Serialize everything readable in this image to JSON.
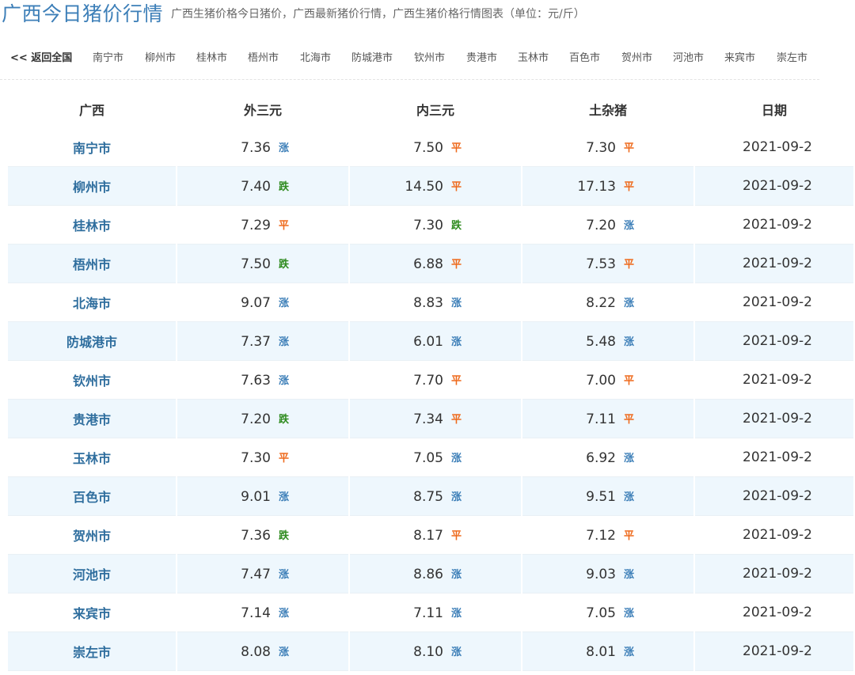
{
  "header": {
    "title": "广西今日猪价行情",
    "subtitle": "广西生猪价格今日猪价，广西最新猪价行情，广西生猪价格行情图表（单位：元/斤）"
  },
  "nav": {
    "back_label": "<< 返回全国",
    "cities": [
      "南宁市",
      "柳州市",
      "桂林市",
      "梧州市",
      "北海市",
      "防城港市",
      "钦州市",
      "贵港市",
      "玉林市",
      "百色市",
      "贺州市",
      "河池市",
      "来宾市",
      "崇左市"
    ]
  },
  "table": {
    "headers": [
      "广西",
      "外三元",
      "内三元",
      "土杂猪",
      "日期"
    ],
    "rows": [
      {
        "city": "南宁市",
        "wai": "7.36",
        "wai_trend": "涨",
        "nei": "7.50",
        "nei_trend": "平",
        "tu": "7.30",
        "tu_trend": "平",
        "date": "2021-09-2"
      },
      {
        "city": "柳州市",
        "wai": "7.40",
        "wai_trend": "跌",
        "nei": "14.50",
        "nei_trend": "平",
        "tu": "17.13",
        "tu_trend": "平",
        "date": "2021-09-2"
      },
      {
        "city": "桂林市",
        "wai": "7.29",
        "wai_trend": "平",
        "nei": "7.30",
        "nei_trend": "跌",
        "tu": "7.20",
        "tu_trend": "涨",
        "date": "2021-09-2"
      },
      {
        "city": "梧州市",
        "wai": "7.50",
        "wai_trend": "跌",
        "nei": "6.88",
        "nei_trend": "平",
        "tu": "7.53",
        "tu_trend": "平",
        "date": "2021-09-2"
      },
      {
        "city": "北海市",
        "wai": "9.07",
        "wai_trend": "涨",
        "nei": "8.83",
        "nei_trend": "涨",
        "tu": "8.22",
        "tu_trend": "涨",
        "date": "2021-09-2"
      },
      {
        "city": "防城港市",
        "wai": "7.37",
        "wai_trend": "涨",
        "nei": "6.01",
        "nei_trend": "涨",
        "tu": "5.48",
        "tu_trend": "涨",
        "date": "2021-09-2"
      },
      {
        "city": "钦州市",
        "wai": "7.63",
        "wai_trend": "涨",
        "nei": "7.70",
        "nei_trend": "平",
        "tu": "7.00",
        "tu_trend": "平",
        "date": "2021-09-2"
      },
      {
        "city": "贵港市",
        "wai": "7.20",
        "wai_trend": "跌",
        "nei": "7.34",
        "nei_trend": "平",
        "tu": "7.11",
        "tu_trend": "平",
        "date": "2021-09-2"
      },
      {
        "city": "玉林市",
        "wai": "7.30",
        "wai_trend": "平",
        "nei": "7.05",
        "nei_trend": "涨",
        "tu": "6.92",
        "tu_trend": "涨",
        "date": "2021-09-2"
      },
      {
        "city": "百色市",
        "wai": "9.01",
        "wai_trend": "涨",
        "nei": "8.75",
        "nei_trend": "涨",
        "tu": "9.51",
        "tu_trend": "涨",
        "date": "2021-09-2"
      },
      {
        "city": "贺州市",
        "wai": "7.36",
        "wai_trend": "跌",
        "nei": "8.17",
        "nei_trend": "平",
        "tu": "7.12",
        "tu_trend": "平",
        "date": "2021-09-2"
      },
      {
        "city": "河池市",
        "wai": "7.47",
        "wai_trend": "涨",
        "nei": "8.86",
        "nei_trend": "涨",
        "tu": "9.03",
        "tu_trend": "涨",
        "date": "2021-09-2"
      },
      {
        "city": "来宾市",
        "wai": "7.14",
        "wai_trend": "涨",
        "nei": "7.11",
        "nei_trend": "涨",
        "tu": "7.05",
        "tu_trend": "涨",
        "date": "2021-09-2"
      },
      {
        "city": "崇左市",
        "wai": "8.08",
        "wai_trend": "涨",
        "nei": "8.10",
        "nei_trend": "涨",
        "tu": "8.01",
        "tu_trend": "涨",
        "date": "2021-09-2"
      }
    ]
  },
  "colors": {
    "title": "#3d7fb8",
    "city_link": "#2f6e9e",
    "trend_up": "#3d7fb8",
    "trend_down": "#2e8b1e",
    "trend_flat": "#ee6a1c",
    "row_stripe": "#eef7fd"
  }
}
